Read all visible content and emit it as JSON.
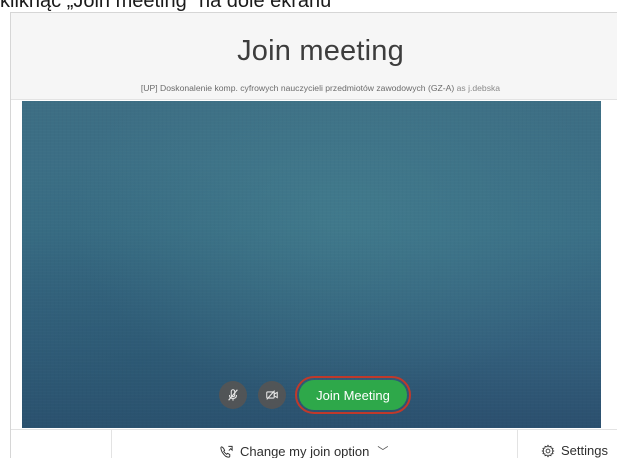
{
  "document": {
    "caption": "kliknąć „Join meeting” na dole ekranu"
  },
  "dialog": {
    "title": "Join meeting",
    "meeting_name": "[UP] Doskonalenie komp. cyfrowych nauczycieli przedmiotów zawodowych (GZ-A)",
    "as_text": "as j.debska"
  },
  "controls": {
    "mute_icon": "microphone-muted-icon",
    "video_icon": "camera-off-icon",
    "join_label": "Join Meeting"
  },
  "footer": {
    "change_option_label": "Change my join option",
    "change_option_icon": "call-icon",
    "settings_label": "Settings",
    "settings_icon": "gear-icon"
  },
  "colors": {
    "join_button": "#2ea84a",
    "highlight_ring": "#c0392b",
    "video_bg": "#3a6f86",
    "control_button": "#555555"
  }
}
